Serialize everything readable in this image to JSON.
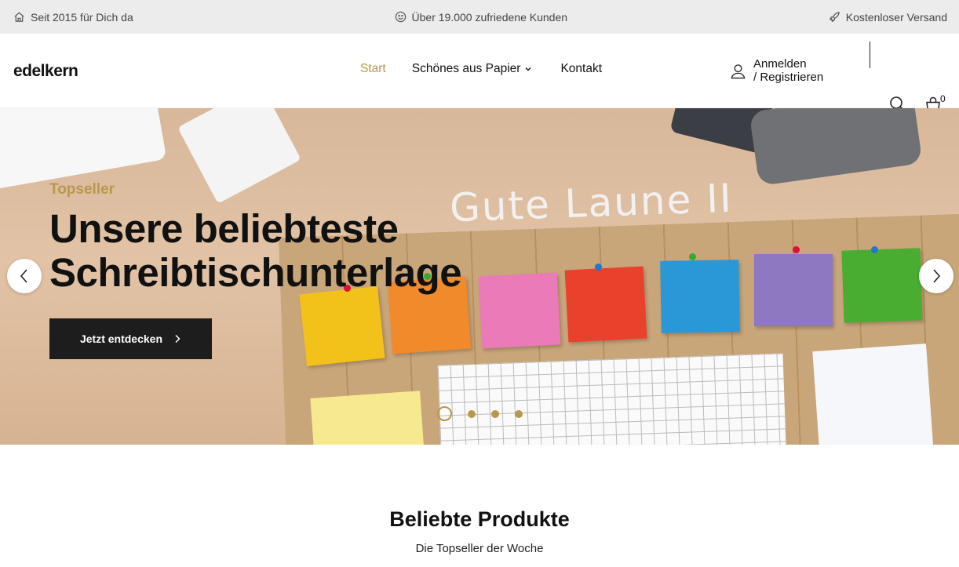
{
  "topbar": {
    "left": "Seit 2015 für Dich da",
    "center": "Über 19.000 zufriedene Kunden",
    "right": "Kostenloser Versand"
  },
  "header": {
    "logo": "edelkern",
    "nav": [
      {
        "label": "Start",
        "active": true
      },
      {
        "label": "Schönes aus Papier",
        "has_dropdown": true
      },
      {
        "label": "Kontakt"
      }
    ],
    "account_line1": "Anmelden",
    "account_line2": "/ Registrieren",
    "cart_count": "0"
  },
  "hero": {
    "kicker": "Topseller",
    "headline_line1": "Unsere beliebteste",
    "headline_line2": "Schreibtischunterlage",
    "cta": "Jetzt entdecken",
    "image_text": "Gute Laune II",
    "slides": 4,
    "active_slide": 1
  },
  "section": {
    "title": "Beliebte Produkte",
    "subtitle": "Die Topseller der Woche"
  },
  "colors": {
    "accent": "#b8984a",
    "dark": "#1d1d1d",
    "topbar_bg": "#ececec"
  }
}
